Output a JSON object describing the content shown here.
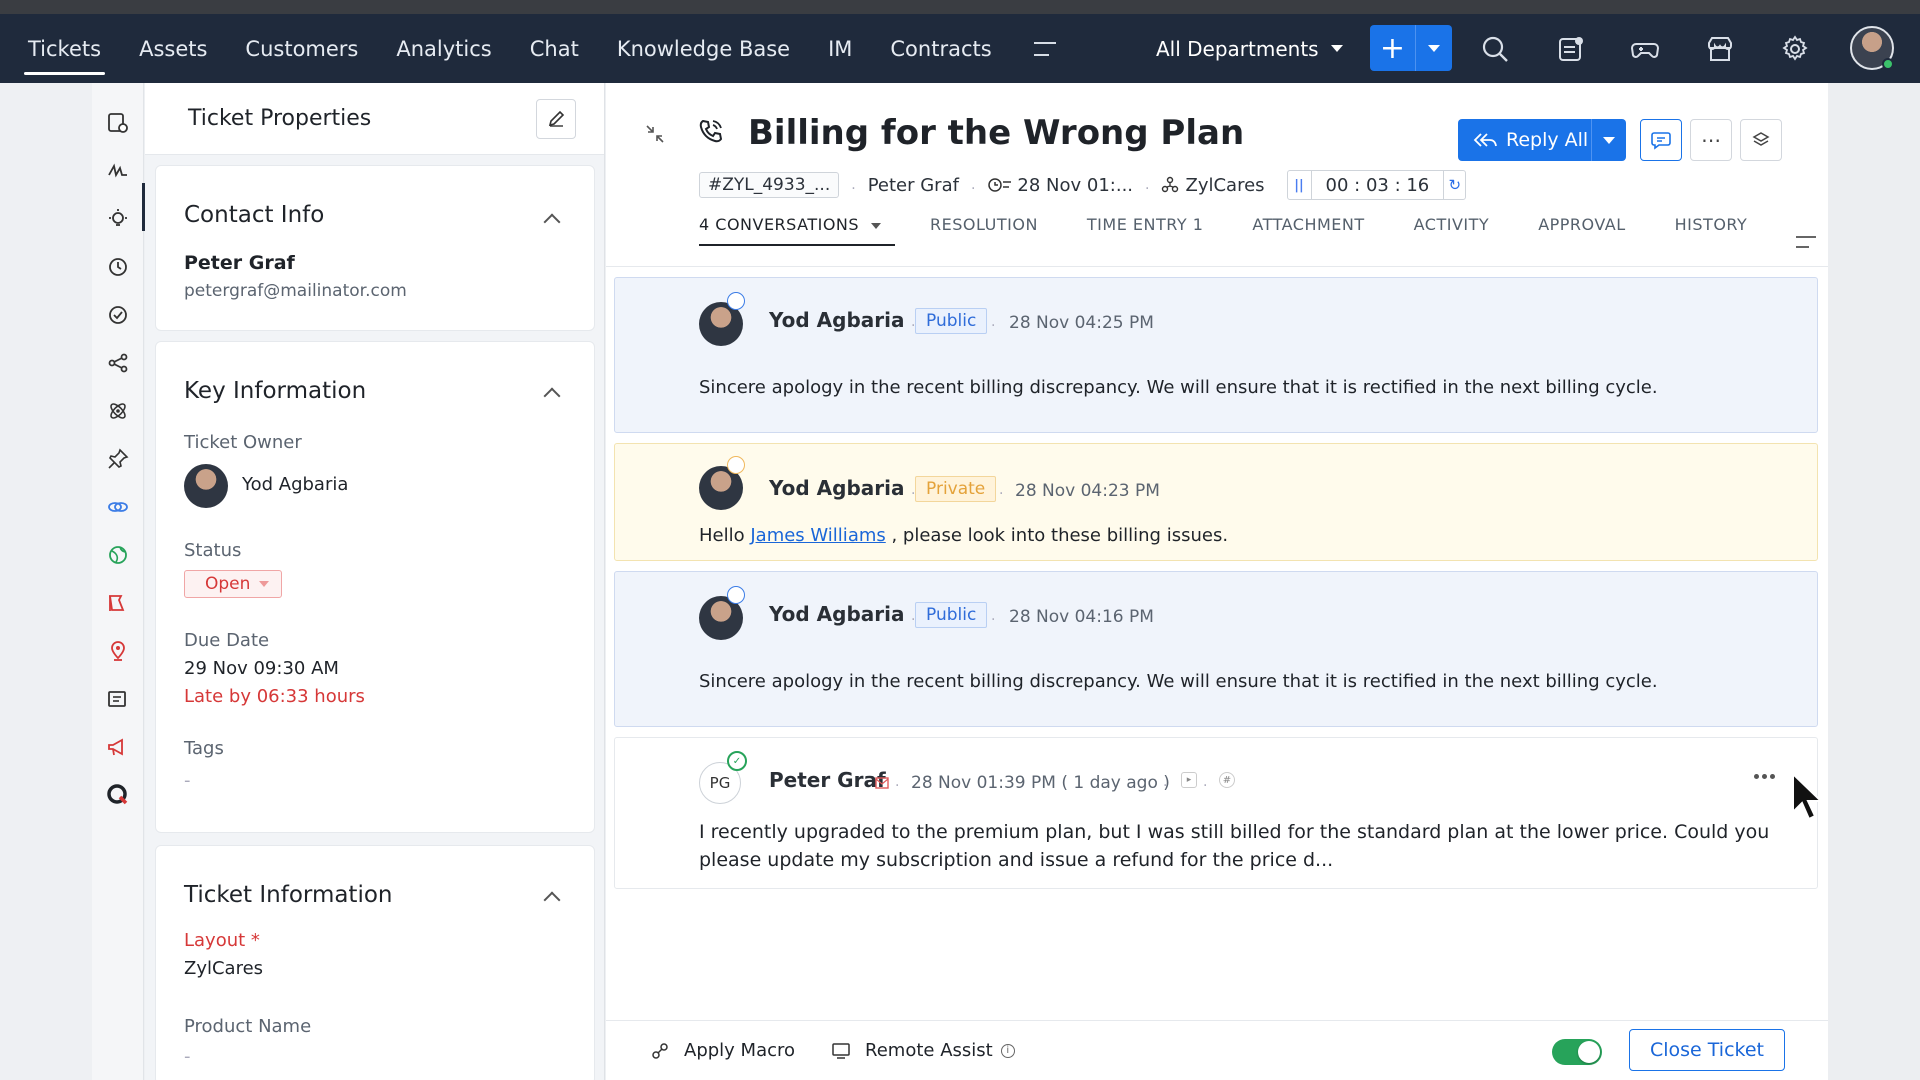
{
  "topnav": {
    "items": [
      "Tickets",
      "Assets",
      "Customers",
      "Analytics",
      "Chat",
      "Knowledge Base",
      "IM",
      "Contracts"
    ],
    "department": "All Departments"
  },
  "properties": {
    "header": "Ticket Properties",
    "contact": {
      "title": "Contact Info",
      "name": "Peter Graf",
      "email": "petergraf@mailinator.com"
    },
    "key_info": {
      "title": "Key Information",
      "owner_label": "Ticket Owner",
      "owner_name": "Yod Agbaria",
      "status_label": "Status",
      "status_value": "Open",
      "due_label": "Due Date",
      "due_value": "29 Nov 09:30 AM",
      "late_text": "Late by 06:33 hours",
      "tags_label": "Tags",
      "tags_value": "-"
    },
    "ticket_info": {
      "title": "Ticket Information",
      "layout_label": "Layout *",
      "layout_value": "ZylCares",
      "product_label": "Product Name",
      "product_value": "-"
    }
  },
  "ticket": {
    "title": "Billing for the Wrong Plan",
    "id": "#ZYL_4933_...",
    "contact": "Peter Graf",
    "created": "28 Nov 01:...",
    "account": "ZylCares",
    "timer": "00 : 03 : 16",
    "reply_label": "Reply All"
  },
  "tabs": [
    "4 CONVERSATIONS",
    "RESOLUTION",
    "TIME ENTRY 1",
    "ATTACHMENT",
    "ACTIVITY",
    "APPROVAL",
    "HISTORY"
  ],
  "threads": [
    {
      "author": "Yod Agbaria",
      "visibility": "Public",
      "time": "28 Nov 04:25 PM",
      "body": "Sincere apology in the recent billing discrepancy. We will ensure that it is rectified in the next billing cycle."
    },
    {
      "author": "Yod Agbaria",
      "visibility": "Private",
      "time": "28 Nov 04:23 PM",
      "body_prefix": "Hello ",
      "mention": "James Williams",
      "body_suffix": " , please look into these billing issues."
    },
    {
      "author": "Yod Agbaria",
      "visibility": "Public",
      "time": "28 Nov 04:16 PM",
      "body": "Sincere apology in the recent billing discrepancy. We will ensure that it is rectified in the next billing cycle."
    },
    {
      "author": "Peter Graf",
      "initials": "PG",
      "time": "28 Nov 01:39 PM ( 1 day ago )",
      "body_line1": "I recently upgraded to the premium plan, but I was still billed for the standard plan at the lower price. Could you",
      "body_line2": "please update my subscription and issue a refund for the price d..."
    }
  ],
  "footer": {
    "apply_macro": "Apply Macro",
    "remote_assist": "Remote Assist",
    "close_ticket": "Close Ticket"
  },
  "colors": {
    "nav_bg": "#1f2a3c",
    "accent": "#1a73e8",
    "status_red": "#d63838",
    "toggle_on": "#27a35a"
  }
}
